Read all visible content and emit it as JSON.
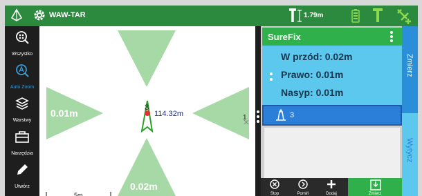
{
  "topbar": {
    "project_name": "WAW-TAR",
    "antenna_height": "1.79m",
    "icons": [
      "layers-icon",
      "gear-icon",
      "antenna-height-icon",
      "battery-icon",
      "antenna-icon",
      "satellite-icon"
    ]
  },
  "toolbar": {
    "items": [
      {
        "label": "Wszystko",
        "icon": "zoom-all-icon"
      },
      {
        "label": "Auto Zoom",
        "icon": "auto-zoom-icon",
        "active": true
      },
      {
        "label": "Warstwy",
        "icon": "layers-icon"
      },
      {
        "label": "Narzędzia",
        "icon": "toolbox-icon"
      },
      {
        "label": "Utwórz",
        "icon": "pencil-icon"
      }
    ]
  },
  "map": {
    "left_offset": "0.01m",
    "bottom_offset": "0.02m",
    "distance": "114.32m",
    "point_number": "3",
    "edge_number": "1",
    "scale": "5m"
  },
  "panel": {
    "title": "SureFix",
    "forward": "W przód: 0.02m",
    "right": "Prawo: 0.01m",
    "fill": "Nasyp: 0.01m",
    "point_label": "3"
  },
  "buttons": {
    "stop": "Stop",
    "skip": "Pomiń",
    "add": "Dodaj",
    "measure": "Zmierz"
  },
  "tabs": {
    "measure": "Zmierz",
    "stakeout": "Wytycz"
  },
  "colors": {
    "header_green": "#2b8a3e",
    "surefix_green": "#2fb04a",
    "info_blue": "#5cc8ee",
    "row_blue": "#2b7fd8",
    "arrow_green": "#a6d9a6"
  }
}
